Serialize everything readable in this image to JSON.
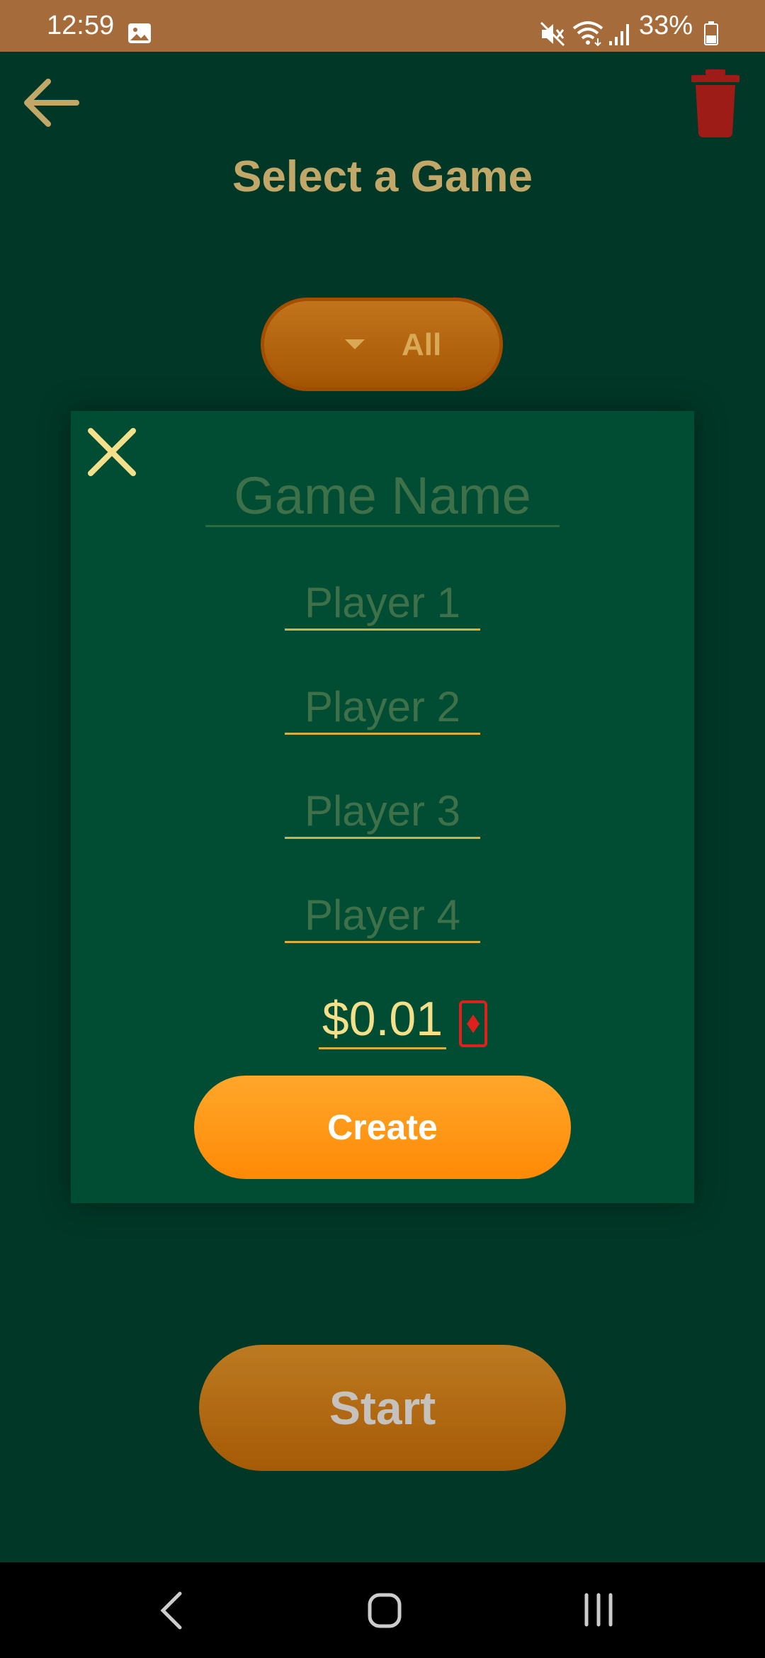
{
  "status_bar": {
    "time": "12:59",
    "battery": "33%",
    "icons": [
      "image-icon",
      "mute-icon",
      "wifi-icon",
      "signal-icon",
      "battery-icon"
    ]
  },
  "header": {
    "title": "Select a Game",
    "back_icon": "arrow-left-icon",
    "trash_icon": "trash-icon"
  },
  "filter": {
    "selected": "All",
    "icon": "caret-down-icon"
  },
  "dialog": {
    "close_icon": "close-icon",
    "game_name_placeholder": "Game Name",
    "players": [
      {
        "placeholder": "Player 1"
      },
      {
        "placeholder": "Player 2"
      },
      {
        "placeholder": "Player 3"
      },
      {
        "placeholder": "Player 4"
      }
    ],
    "stake": "$0.01",
    "card_icon": "diamond-card-icon",
    "create_label": "Create"
  },
  "start_label": "Start",
  "colors": {
    "background": "#003726",
    "dialog": "#014d34",
    "accent_orange": "#ff8a05",
    "title_gold": "#c1a868",
    "trash_red": "#9e1c17"
  }
}
